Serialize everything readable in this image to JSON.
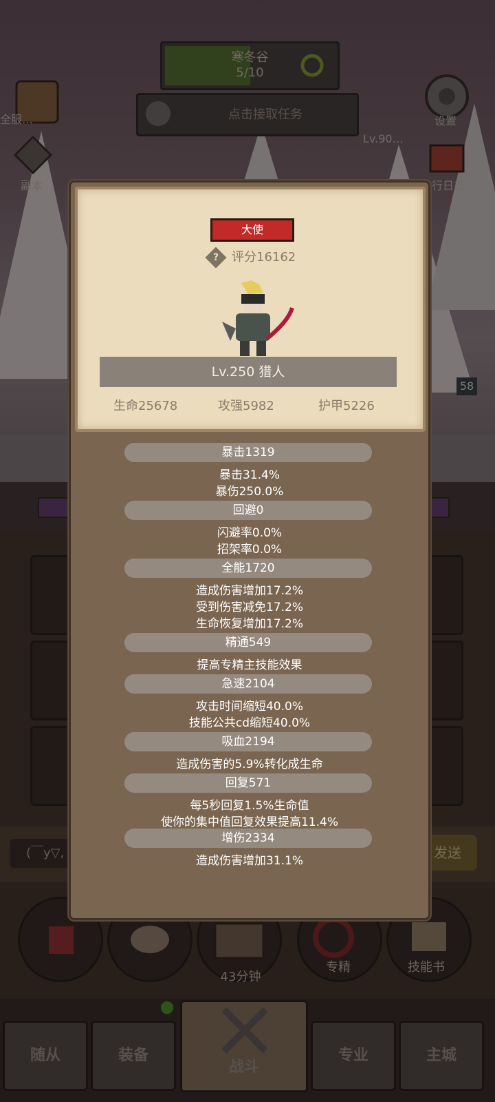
{
  "hud": {
    "progress_title": "寒冬谷",
    "progress_value": "5/10",
    "progress_fraction": 0.5,
    "quest_label": "点击接取任务",
    "settings_label": "设置",
    "dungeon_label": "副本",
    "log_label": "旅行日志",
    "ticker_left": "全服…",
    "ticker_right": "Lv.90…",
    "level_badge": "58",
    "chat_placeholder": "(￣y▽,",
    "send_label": "发送"
  },
  "actions": [
    {
      "label": ""
    },
    {
      "label": ""
    },
    {
      "label": "43分钟"
    },
    {
      "label": "专精"
    },
    {
      "label": "技能书"
    }
  ],
  "nav": [
    {
      "label": "随从"
    },
    {
      "label": "装备"
    },
    {
      "label": "战斗"
    },
    {
      "label": "专业"
    },
    {
      "label": "主城"
    }
  ],
  "popup": {
    "title_badge": "大使",
    "score": "评分16162",
    "name": "Lv.250 猎人",
    "stats": {
      "hp": "生命25678",
      "atk": "攻强5982",
      "armor": "护甲5226"
    },
    "sections": [
      {
        "head": "暴击1319",
        "lines": [
          "暴击31.4%",
          "暴伤250.0%"
        ]
      },
      {
        "head": "回避0",
        "lines": [
          "闪避率0.0%",
          "招架率0.0%"
        ]
      },
      {
        "head": "全能1720",
        "lines": [
          "造成伤害增加17.2%",
          "受到伤害减免17.2%",
          "生命恢复增加17.2%"
        ]
      },
      {
        "head": "精通549",
        "lines": [
          "提高专精主技能效果"
        ]
      },
      {
        "head": "急速2104",
        "lines": [
          "攻击时间缩短40.0%",
          "技能公共cd缩短40.0%"
        ]
      },
      {
        "head": "吸血2194",
        "lines": [
          "造成伤害的5.9%转化成生命"
        ]
      },
      {
        "head": "回复571",
        "lines": [
          "每5秒回复1.5%生命值",
          "使你的集中值回复效果提高11.4%"
        ]
      },
      {
        "head": "增伤2334",
        "lines": [
          "造成伤害增加31.1%"
        ]
      }
    ]
  },
  "colors": {
    "popup_bg": "#7a6650",
    "card_bg": "#eadcbc",
    "badge_red": "#c22a2a",
    "section_head": "#958a80"
  }
}
